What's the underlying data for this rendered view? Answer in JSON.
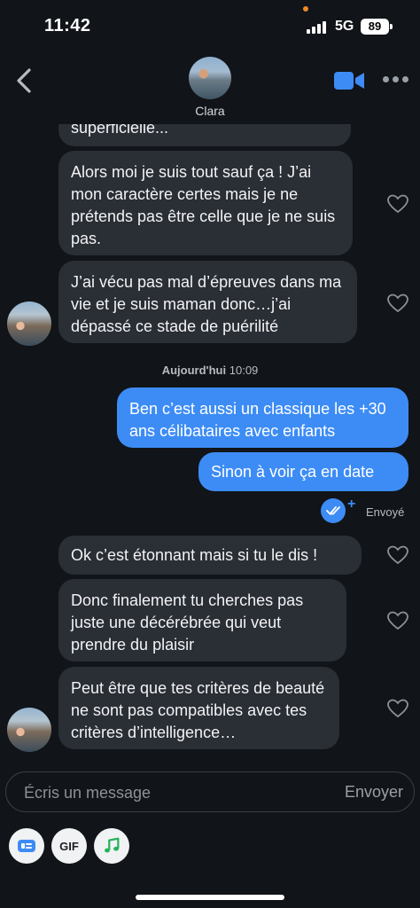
{
  "status_bar": {
    "time": "11:42",
    "network": "5G",
    "battery": "89"
  },
  "header": {
    "contact_name": "Clara"
  },
  "colors": {
    "accent": "#3d8cf5",
    "bubble_in": "#2a2e35",
    "background": "#111418"
  },
  "messages_before": [
    {
      "text": "superficielle..."
    },
    {
      "text": "Alors moi je suis tout sauf ça ! J’ai mon caractère certes mais je ne prétends pas être celle que je ne suis pas."
    },
    {
      "text": "J’ai vécu pas mal d’épreuves dans ma vie et je suis maman donc…j’ai dépassé ce stade de puérilité"
    }
  ],
  "divider": {
    "day": "Aujourd'hui",
    "time": "10:09"
  },
  "messages_sent": [
    {
      "text": "Ben c’est aussi un classique les +30 ans célibataires avec enfants"
    },
    {
      "text": "Sinon à voir ça en date"
    }
  ],
  "sent_status": "Envoyé",
  "messages_after": [
    {
      "text": "Ok c’est étonnant mais si tu le dis !"
    },
    {
      "text": "Donc finalement tu cherches pas juste une décérébrée qui veut prendre du plaisir"
    },
    {
      "text": "Peut être que tes critères de beauté ne sont pas compatibles avec tes critères d’intelligence…"
    }
  ],
  "composer": {
    "placeholder": "Écris un message",
    "send_label": "Envoyer"
  },
  "toolbar": {
    "gif_label": "GIF",
    "icons": [
      "sticker-icon",
      "gif-icon",
      "music-note-icon"
    ]
  }
}
